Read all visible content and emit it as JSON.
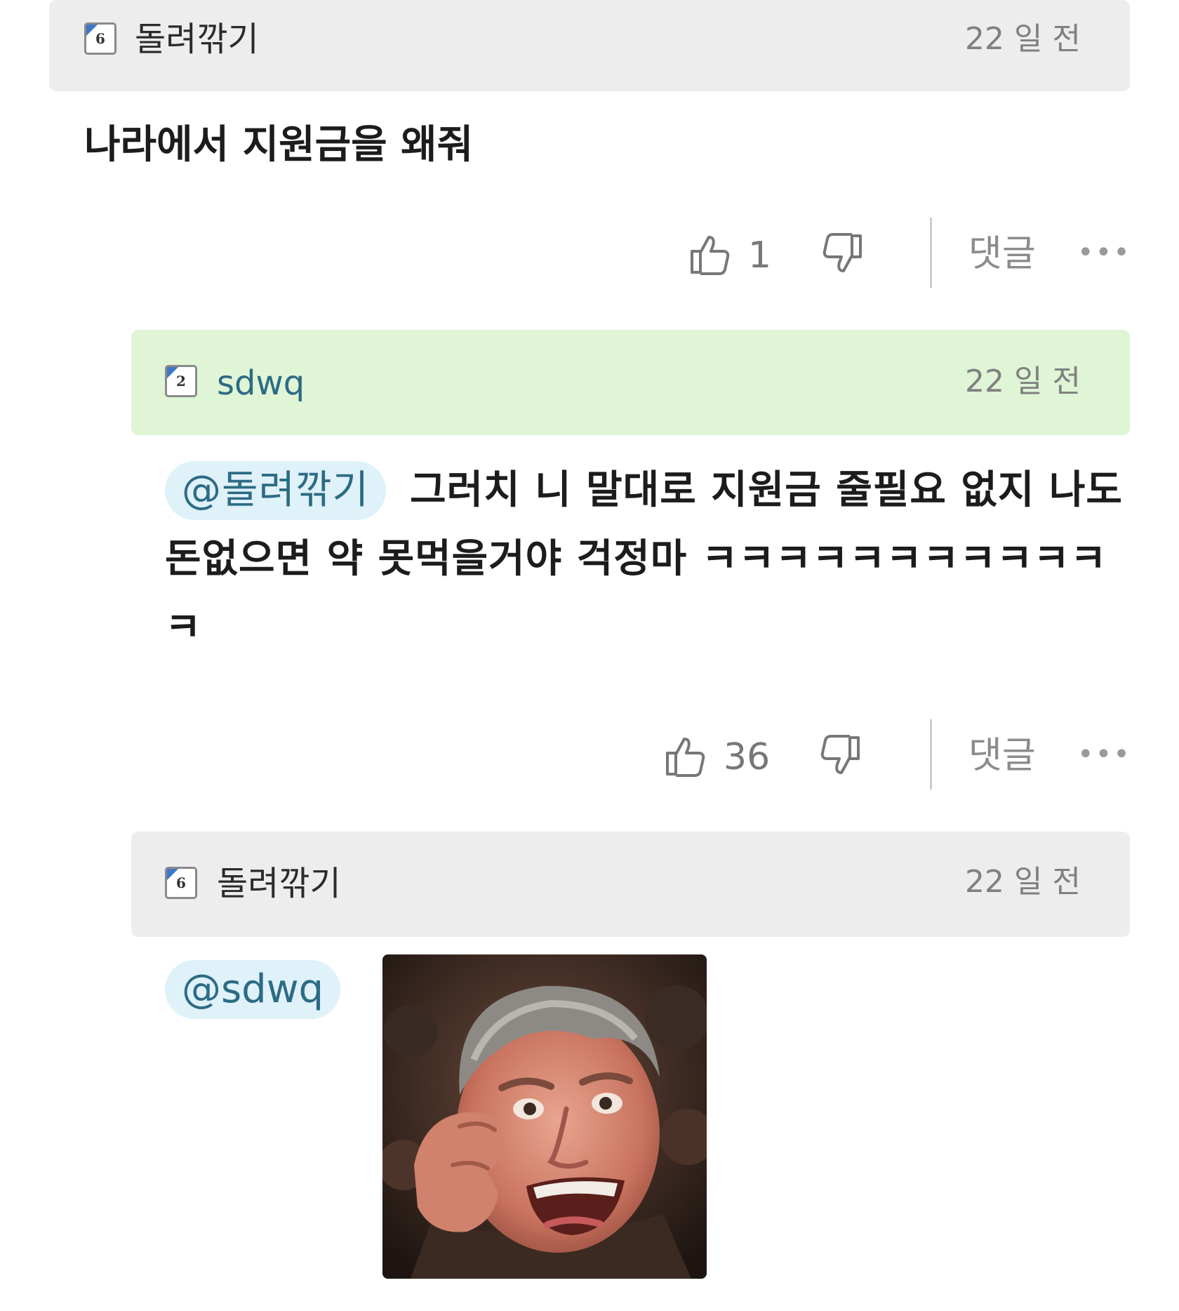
{
  "comments": [
    {
      "author": "돌려깎기",
      "level": "6",
      "time": "22 일 전",
      "text": "나라에서 지원금을 왜줘",
      "likes": "1",
      "reply_label": "댓글",
      "more": "•••"
    },
    {
      "author": "sdwq",
      "level": "2",
      "time": "22 일 전",
      "mention": "@돌려깎기",
      "text": "그러치 니 말대로 지원금 줄필요 없지 나도 돈없으면 약 못먹을거야 걱정마 ㅋㅋㅋㅋㅋㅋㅋㅋㅋㅋㅋㅋ",
      "likes": "36",
      "reply_label": "댓글",
      "more": "•••"
    },
    {
      "author": "돌려깎기",
      "level": "6",
      "time": "22 일 전",
      "mention": "@sdwq",
      "image": "shocked-man-reaction-photo"
    }
  ],
  "colors": {
    "header_gray": "#ededed",
    "header_highlight": "#dff5d6",
    "mention_bg": "#dff1f9",
    "mention_text": "#2c6b84",
    "level_corner": "#3d78c8"
  },
  "icons": [
    "level-badge-icon",
    "thumbs-up-icon",
    "thumbs-down-icon",
    "more-dots-icon"
  ]
}
